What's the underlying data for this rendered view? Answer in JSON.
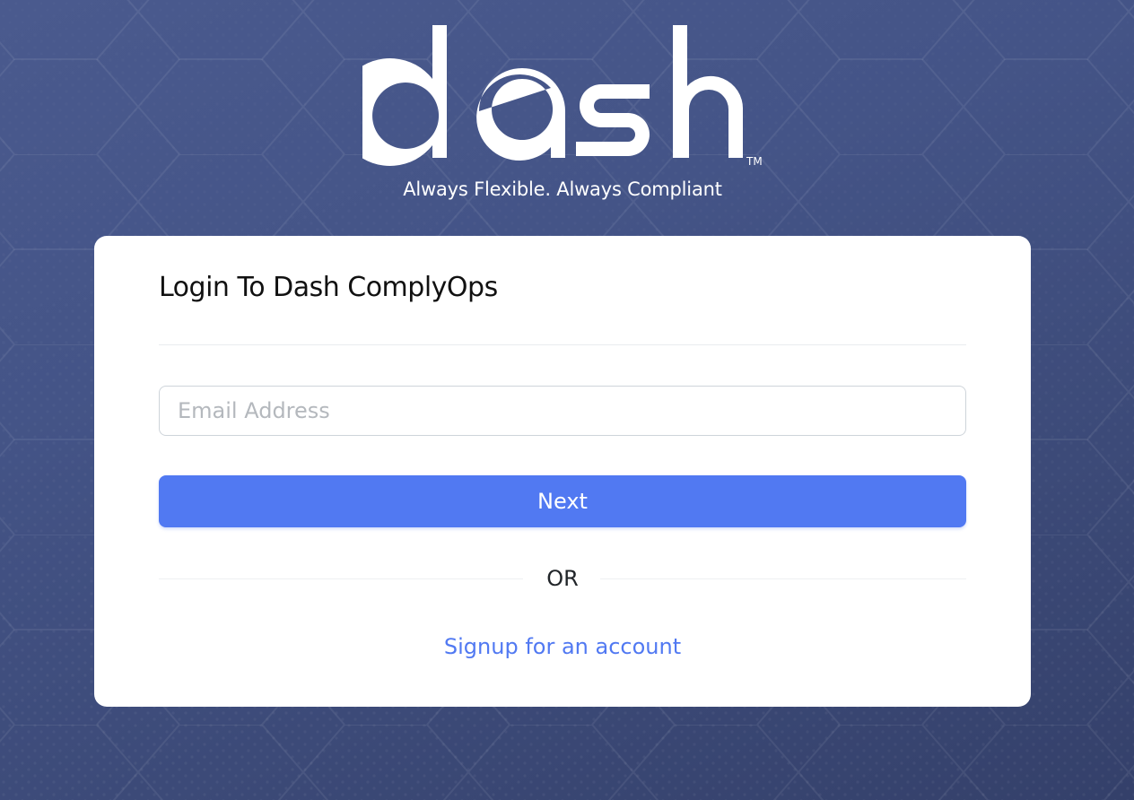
{
  "brand": {
    "logo_text": "dash",
    "trademark": "TM",
    "tagline": "Always Flexible. Always Compliant"
  },
  "login": {
    "title": "Login To Dash ComplyOps",
    "email_placeholder": "Email Address",
    "email_value": "",
    "next_label": "Next",
    "or_label": "OR",
    "signup_label": "Signup for an account"
  },
  "colors": {
    "background": "#445487",
    "card": "#ffffff",
    "primary": "#5179f2",
    "link": "#5179f2"
  }
}
